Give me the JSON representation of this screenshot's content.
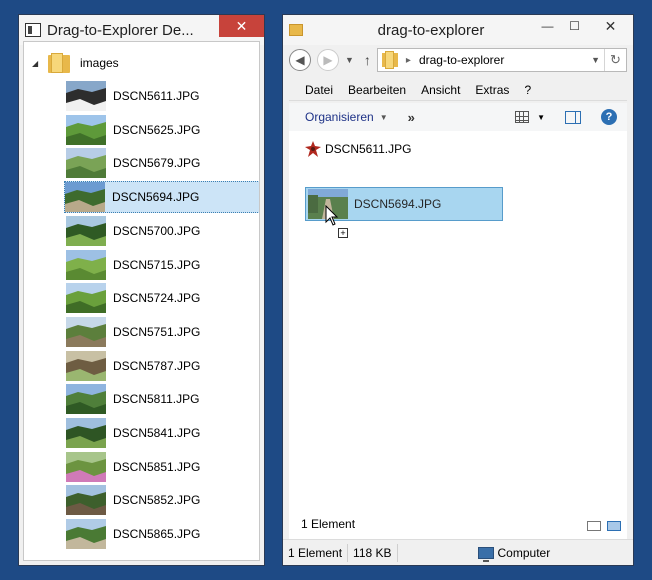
{
  "left_window": {
    "title": "Drag-to-Explorer De...",
    "minimize": "—",
    "maximize": "☐",
    "close": "✕",
    "tree": {
      "root_label": "images",
      "files": [
        {
          "name": "DSCN5611.JPG",
          "thumb": "car-interior",
          "selected": false
        },
        {
          "name": "DSCN5625.JPG",
          "thumb": "green-hills",
          "selected": false
        },
        {
          "name": "DSCN5679.JPG",
          "thumb": "valley",
          "selected": false
        },
        {
          "name": "DSCN5694.JPG",
          "thumb": "forest-path",
          "selected": true
        },
        {
          "name": "DSCN5700.JPG",
          "thumb": "trees",
          "selected": false
        },
        {
          "name": "DSCN5715.JPG",
          "thumb": "meadow",
          "selected": false
        },
        {
          "name": "DSCN5724.JPG",
          "thumb": "green-field",
          "selected": false
        },
        {
          "name": "DSCN5751.JPG",
          "thumb": "farmhouse",
          "selected": false
        },
        {
          "name": "DSCN5787.JPG",
          "thumb": "tree-trunk",
          "selected": false
        },
        {
          "name": "DSCN5811.JPG",
          "thumb": "hills-sky",
          "selected": false
        },
        {
          "name": "DSCN5841.JPG",
          "thumb": "forest-edge",
          "selected": false
        },
        {
          "name": "DSCN5851.JPG",
          "thumb": "flowers",
          "selected": false
        },
        {
          "name": "DSCN5852.JPG",
          "thumb": "cabin",
          "selected": false
        },
        {
          "name": "DSCN5865.JPG",
          "thumb": "gravel-road",
          "selected": false
        }
      ]
    }
  },
  "right_window": {
    "title": "drag-to-explorer",
    "minimize": "—",
    "maximize": "☐",
    "close": "✕",
    "address": "drag-to-explorer",
    "menu": [
      "Datei",
      "Bearbeiten",
      "Ansicht",
      "Extras",
      "?"
    ],
    "organize": "Organisieren",
    "more": "»",
    "content": {
      "file": "DSCN5611.JPG",
      "drag_file": "DSCN5694.JPG",
      "count": "1 Element"
    },
    "status": {
      "count": "1 Element",
      "size": "118 KB",
      "location": "Computer"
    }
  },
  "colors": {
    "desktop": "#1e4a85",
    "close_button": "#c7433b",
    "selection": "#cce4f7",
    "accent": "#1e3287"
  }
}
